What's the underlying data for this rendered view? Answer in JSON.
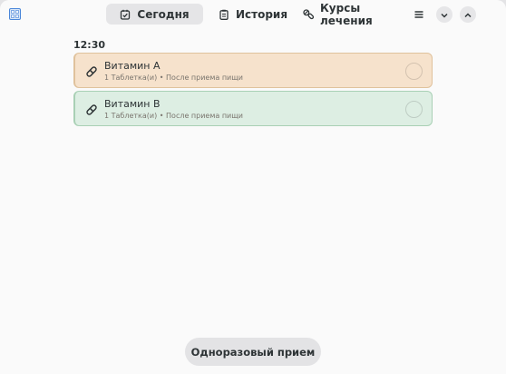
{
  "header": {
    "app_icon": "app-grid-icon",
    "tabs": [
      {
        "label": "Сегодня",
        "icon": "calendar-check-icon",
        "active": true
      },
      {
        "label": "История",
        "icon": "clipboard-icon",
        "active": false
      },
      {
        "label": "Курсы лечения",
        "icon": "pills-icon",
        "active": false
      }
    ],
    "controls": [
      "menu-icon",
      "minimize-icon",
      "maximize-icon"
    ]
  },
  "schedule": {
    "time": "12:30",
    "items": [
      {
        "name": "Витамин А",
        "details": "1 Таблетка(и) • После приема пищи",
        "color": "#f6e2cc",
        "accent": "#e0c29c",
        "taken": false
      },
      {
        "name": "Витамин B",
        "details": "1 Таблетка(и) • После приема пищи",
        "color": "#ddeee3",
        "accent": "#a9d0b5",
        "taken": false
      }
    ]
  },
  "footer": {
    "once_button_label": "Одноразовый прием"
  },
  "colors": {
    "window_bg": "#fafafa",
    "active_tab_bg": "#e5e5e7",
    "button_bg": "#e3e3e5",
    "text": "#2e3436"
  }
}
